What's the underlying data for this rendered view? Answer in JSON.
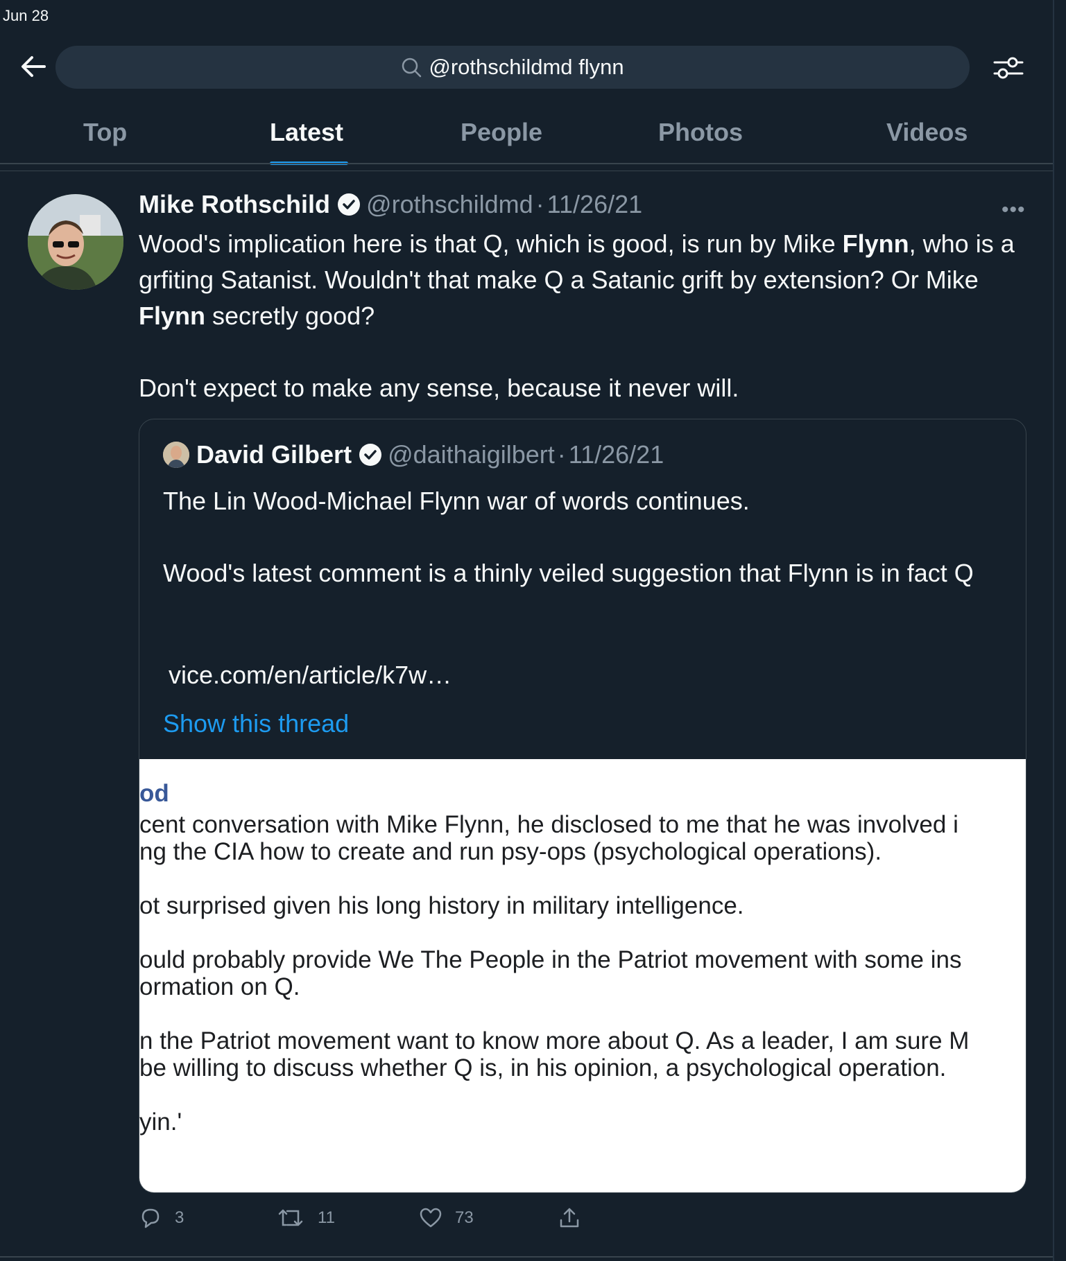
{
  "status_bar": {
    "date": "Jun 28"
  },
  "search": {
    "query": "@rothschildmd flynn"
  },
  "tabs": [
    {
      "label": "Top"
    },
    {
      "label": "Latest"
    },
    {
      "label": "People"
    },
    {
      "label": "Photos"
    },
    {
      "label": "Videos"
    }
  ],
  "active_tab": "Latest",
  "tweet": {
    "name": "Mike Rothschild",
    "handle": "@rothschildmd",
    "sep": "·",
    "date": "11/26/21",
    "text": {
      "p1_a": "Wood's implication here is that Q, which is good, is run by Mike ",
      "p1_b": "Flynn",
      "p1_c": ", who is a grfiting Satanist. Wouldn't that make Q a Satanic grift by extension? Or Mike ",
      "p1_d": "Flynn",
      "p1_e": " secretly good?",
      "p2": "Don't expect to make any sense, because it never will."
    },
    "quote": {
      "name": "David Gilbert",
      "handle": "@daithaigilbert",
      "sep": "·",
      "date": "11/26/21",
      "p1": "The Lin Wood-Michael Flynn war of words continues.",
      "p2": "Wood's latest comment is a thinly veiled suggestion that Flynn is in fact Q",
      "link": "vice.com/en/article/k7w…",
      "show_thread": "Show this thread",
      "image_lines": [
        "od",
        "cent conversation with Mike Flynn, he disclosed to me that he was involved i",
        "ng the CIA how to create and run psy-ops (psychological operations).",
        "ot surprised given his long history in military intelligence.",
        "ould probably provide We The People in the Patriot movement with some ins",
        "ormation on Q.",
        "n the Patriot movement want to know more about Q. As a leader, I am sure M",
        "be willing to discuss whether Q is, in his opinion, a psychological operation.",
        "yin.'"
      ]
    },
    "actions": {
      "replies": "3",
      "retweets": "11",
      "likes": "73"
    }
  },
  "colors": {
    "background": "#15202b",
    "accent": "#1d9bf0",
    "muted": "#8b98a5",
    "text": "#f7f9f9"
  },
  "icons": [
    "back-arrow-icon",
    "search-icon",
    "filter-icon",
    "verified-icon",
    "more-icon",
    "reply-icon",
    "retweet-icon",
    "like-icon",
    "share-icon"
  ]
}
